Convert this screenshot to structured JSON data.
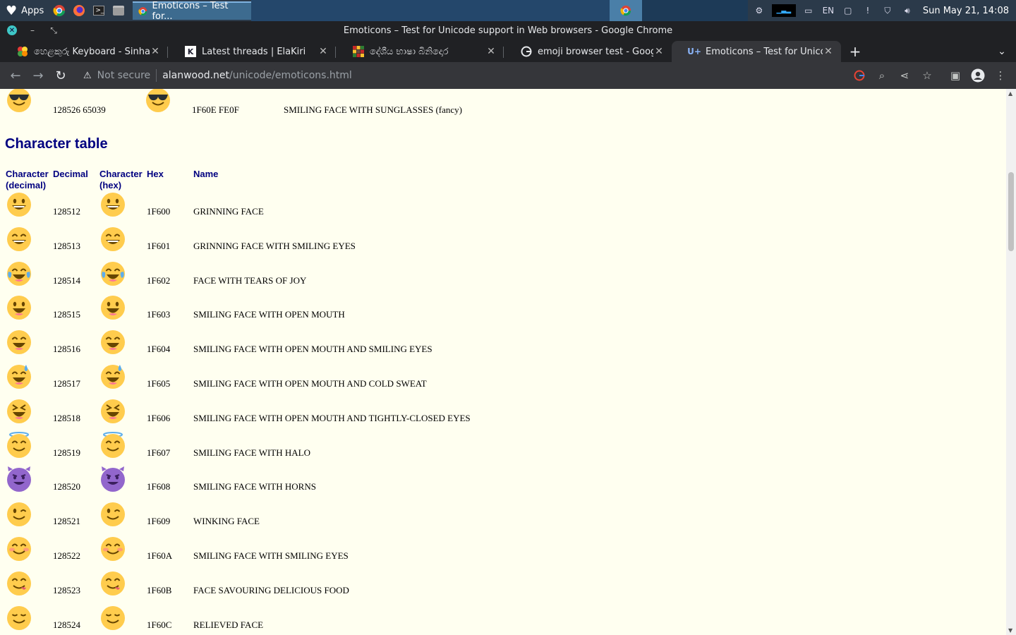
{
  "os": {
    "apps_label": "Apps",
    "active_task": "Emoticons – Test for...",
    "clock": "Sun May 21, 14:08"
  },
  "window": {
    "title": "Emoticons – Test for Unicode support in Web browsers - Google Chrome"
  },
  "tabs": [
    {
      "label": "හෙළකුරු Keyboard - Sinhala",
      "favicon": "flower-icon"
    },
    {
      "label": "Latest threads | ElaKiri",
      "favicon": "elakiri-icon"
    },
    {
      "label": "දේශීය භාෂා බිනිදොර",
      "favicon": "grid-icon"
    },
    {
      "label": "emoji browser test - Google S",
      "favicon": "google-icon"
    },
    {
      "label": "Emoticons – Test for Unicode",
      "favicon": "unicode-icon",
      "active": true
    }
  ],
  "toolbar": {
    "security": "Not secure",
    "url_host": "alanwood.net",
    "url_path": "/unicode/emoticons.html"
  },
  "page": {
    "top_row": {
      "decimal": "128526 65039",
      "hex": "1F60E FE0F",
      "name": "SMILING FACE WITH SUNGLASSES (fancy)",
      "emoji": "sunglasses"
    },
    "section_title": "Character table",
    "headers": {
      "char_dec": "Character (decimal)",
      "decimal": "Decimal",
      "char_hex": "Character (hex)",
      "hex": "Hex",
      "name": "Name"
    },
    "rows": [
      {
        "decimal": "128512",
        "hex": "1F600",
        "name": "GRINNING FACE",
        "emoji": "grin"
      },
      {
        "decimal": "128513",
        "hex": "1F601",
        "name": "GRINNING FACE WITH SMILING EYES",
        "emoji": "beam"
      },
      {
        "decimal": "128514",
        "hex": "1F602",
        "name": "FACE WITH TEARS OF JOY",
        "emoji": "joy"
      },
      {
        "decimal": "128515",
        "hex": "1F603",
        "name": "SMILING FACE WITH OPEN MOUTH",
        "emoji": "smiley"
      },
      {
        "decimal": "128516",
        "hex": "1F604",
        "name": "SMILING FACE WITH OPEN MOUTH AND SMILING EYES",
        "emoji": "smile"
      },
      {
        "decimal": "128517",
        "hex": "1F605",
        "name": "SMILING FACE WITH OPEN MOUTH AND COLD SWEAT",
        "emoji": "sweat"
      },
      {
        "decimal": "128518",
        "hex": "1F606",
        "name": "SMILING FACE WITH OPEN MOUTH AND TIGHTLY-CLOSED EYES",
        "emoji": "laughing"
      },
      {
        "decimal": "128519",
        "hex": "1F607",
        "name": "SMILING FACE WITH HALO",
        "emoji": "halo"
      },
      {
        "decimal": "128520",
        "hex": "1F608",
        "name": "SMILING FACE WITH HORNS",
        "emoji": "horns"
      },
      {
        "decimal": "128521",
        "hex": "1F609",
        "name": "WINKING FACE",
        "emoji": "wink"
      },
      {
        "decimal": "128522",
        "hex": "1F60A",
        "name": "SMILING FACE WITH SMILING EYES",
        "emoji": "blush"
      },
      {
        "decimal": "128523",
        "hex": "1F60B",
        "name": "FACE SAVOURING DELICIOUS FOOD",
        "emoji": "yum"
      },
      {
        "decimal": "128524",
        "hex": "1F60C",
        "name": "RELIEVED FACE",
        "emoji": "relieved"
      }
    ]
  }
}
